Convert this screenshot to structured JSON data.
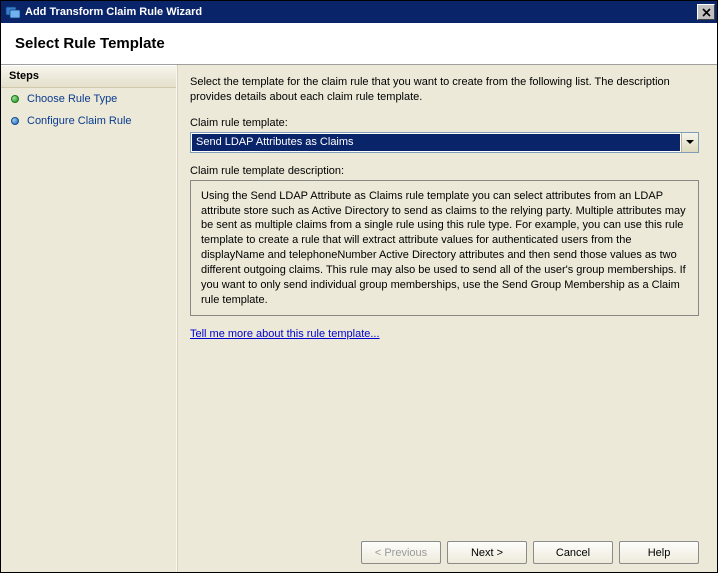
{
  "window": {
    "title": "Add Transform Claim Rule Wizard",
    "page_heading": "Select Rule Template"
  },
  "sidebar": {
    "heading": "Steps",
    "items": [
      {
        "label": "Choose Rule Type",
        "current": true
      },
      {
        "label": "Configure Claim Rule",
        "current": false
      }
    ]
  },
  "main": {
    "intro": "Select the template for the claim rule that you want to create from the following list. The description provides details about each claim rule template.",
    "template_label": "Claim rule template:",
    "template_selected": "Send LDAP Attributes as Claims",
    "description_label": "Claim rule template description:",
    "description_text": "Using the Send LDAP Attribute as Claims rule template you can select attributes from an LDAP attribute store such as Active Directory to send as claims to the relying party. Multiple attributes may be sent as multiple claims from a single rule using this rule type. For example, you can use this rule template to create a rule that will extract attribute values for authenticated users from the displayName and telephoneNumber Active Directory attributes and then send those values as two different outgoing claims. This rule may also be used to send all of the user's group memberships. If you want to only send individual group memberships, use the Send Group Membership as a Claim rule template.",
    "link_text": "Tell me more about this rule template..."
  },
  "buttons": {
    "previous": "< Previous",
    "next": "Next >",
    "cancel": "Cancel",
    "help": "Help"
  }
}
